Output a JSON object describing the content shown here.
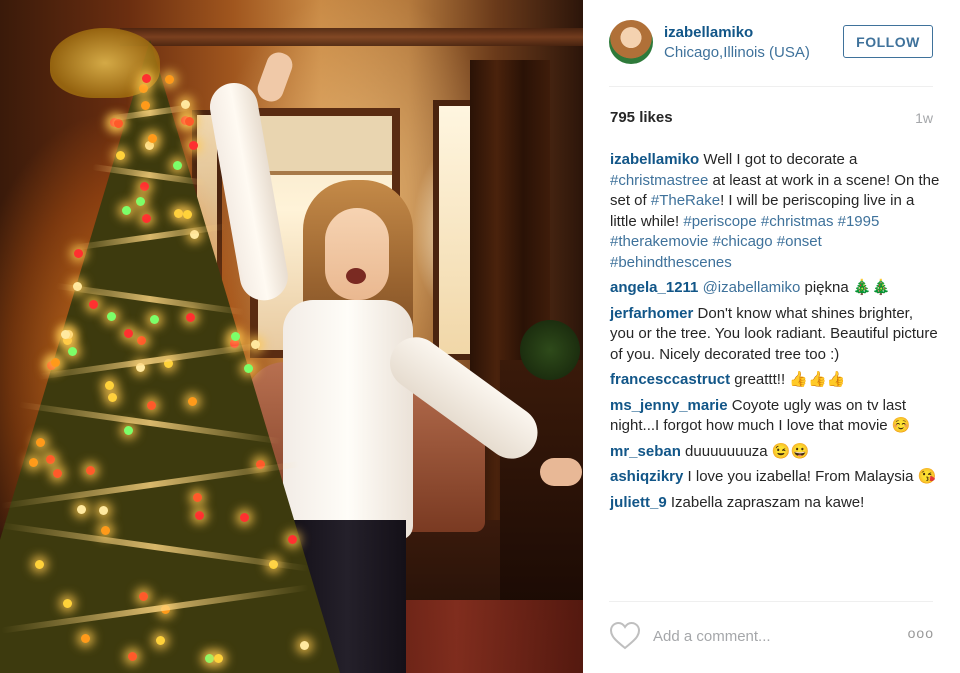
{
  "post": {
    "username": "izabellamiko",
    "location": "Chicago,Illinois (USA)",
    "follow_label": "FOLLOW",
    "likes": "795 likes",
    "time_ago": "1w",
    "add_comment_placeholder": "Add a comment...",
    "more_label": "ooo"
  },
  "caption": {
    "user": "izabellamiko",
    "t1": " Well I got to decorate a ",
    "h1": "#christmastree",
    "t2": " at least at work in a scene! On the set of ",
    "h2": "#TheRake",
    "t3": "! I will be periscoping live in a little while! ",
    "h3": "#periscope",
    "h4": "#christmas",
    "h5": "#1995",
    "h6": "#therakemovie",
    "h7": "#chicago",
    "h8": "#onset",
    "h9": "#behindthescenes"
  },
  "comments": [
    {
      "user": "angela_1211",
      "mention": "@izabellamiko",
      "text": " piękna 🎄🎄"
    },
    {
      "user": "jerfarhomer",
      "text": " Don't know what shines brighter, you or the tree. You look radiant. Beautiful picture of you. Nicely decorated tree too :)"
    },
    {
      "user": "francesccastruct",
      "text": " greattt!! 👍👍👍"
    },
    {
      "user": "ms_jenny_marie",
      "text": " Coyote ugly was on tv last night...I forgot how much I love that movie ☺️"
    },
    {
      "user": "mr_seban",
      "text": " duuuuuuuza 😉😀"
    },
    {
      "user": "ashiqzikry",
      "text": " I love you izabella! From Malaysia 😘"
    },
    {
      "user": "juliett_9",
      "text": " Izabella zapraszam na kawe!"
    }
  ],
  "colors": {
    "username_blue": "#125688",
    "hashtag_blue": "#3f729b",
    "text": "#262626",
    "muted": "#a5a7aa"
  },
  "icons": {
    "like": "heart-outline-icon",
    "more": "more-options-icon"
  }
}
